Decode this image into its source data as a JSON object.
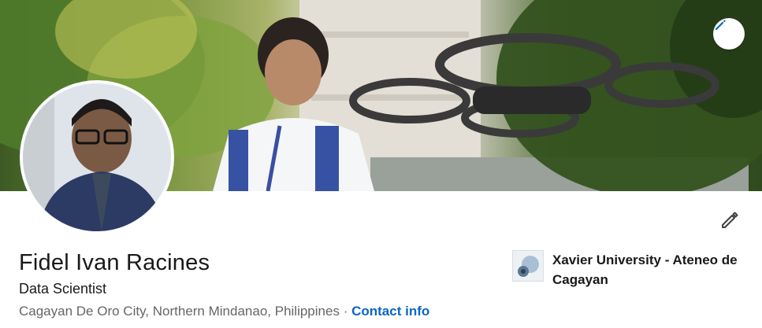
{
  "profile": {
    "name": "Fidel Ivan Racines",
    "headline": "Data Scientist",
    "location": "Cagayan De Oro City, Northern Mindanao, Philippines",
    "separator": "·",
    "contact_info_label": "Contact info"
  },
  "education": {
    "school_name": "Xavier University - Ateneo de Cagayan"
  },
  "icons": {
    "banner_edit": "pencil-icon",
    "profile_edit": "pencil-icon"
  },
  "colors": {
    "link": "#0a66c2",
    "text_primary": "#191919",
    "text_secondary": "#666666"
  }
}
